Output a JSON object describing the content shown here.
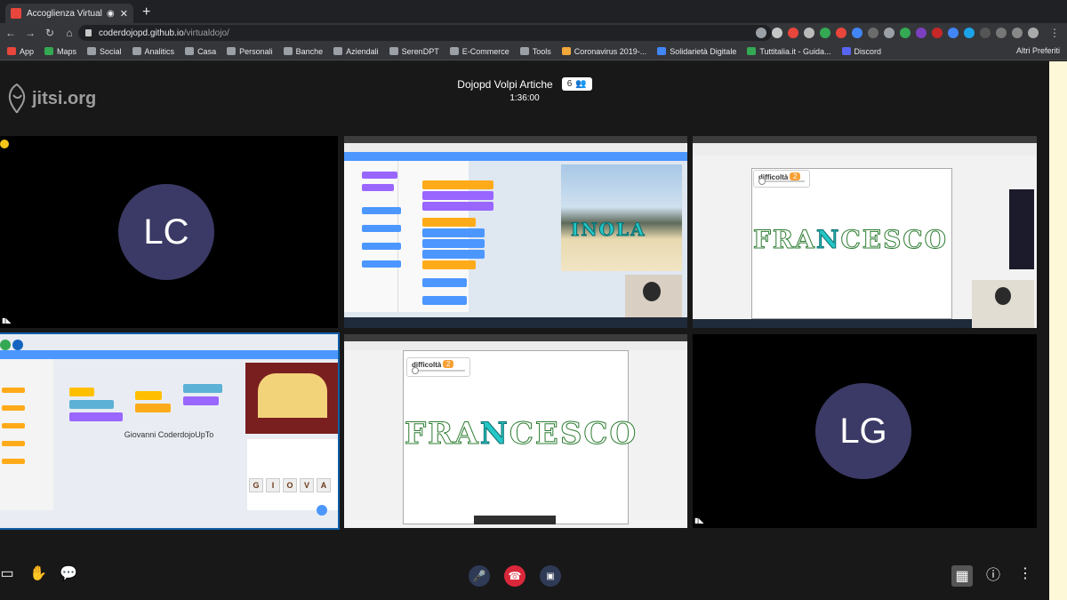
{
  "browser": {
    "tab_title": "Accoglienza Virtual Dojo",
    "url_host": "coderdojopd.github.io",
    "url_path": "/virtualdojo/",
    "bookmarks": [
      {
        "label": "App",
        "color": "#e8453c"
      },
      {
        "label": "Maps",
        "color": "#34a853"
      },
      {
        "label": "Social",
        "color": "#9aa0a6"
      },
      {
        "label": "Analitics",
        "color": "#9aa0a6"
      },
      {
        "label": "Casa",
        "color": "#9aa0a6"
      },
      {
        "label": "Personali",
        "color": "#9aa0a6"
      },
      {
        "label": "Banche",
        "color": "#9aa0a6"
      },
      {
        "label": "Aziendali",
        "color": "#9aa0a6"
      },
      {
        "label": "SerenDPT",
        "color": "#9aa0a6"
      },
      {
        "label": "E-Commerce",
        "color": "#9aa0a6"
      },
      {
        "label": "Tools",
        "color": "#9aa0a6"
      },
      {
        "label": "Coronavirus 2019-...",
        "color": "#f2a93b"
      },
      {
        "label": "Solidarietà Digitale",
        "color": "#4285f4"
      },
      {
        "label": "Tuttitalia.it - Guida...",
        "color": "#34a853"
      },
      {
        "label": "Discord",
        "color": "#5865f2"
      }
    ],
    "bookmarks_right": "Altri Preferiti"
  },
  "conference": {
    "logo": "jitsi.org",
    "title": "Dojopd Volpi Artiche",
    "participants": "6",
    "timer": "1:36:00"
  },
  "tiles": {
    "lc": {
      "initials": "LC"
    },
    "scratch_top": {
      "word": "INOLA"
    },
    "francesco_top": {
      "diff_label": "difficoltà",
      "diff_value": "2",
      "word_pre": "FRA",
      "word_hl": "N",
      "word_post": "CESCO"
    },
    "giovanni": {
      "name": "Giovanni CoderdojoUpTo",
      "letters": [
        "G",
        "I",
        "O",
        "V",
        "A"
      ]
    },
    "francesco_bottom": {
      "diff_label": "difficoltà",
      "diff_value": "2",
      "word_pre": "FRA",
      "word_hl": "N",
      "word_post": "CESCO"
    },
    "lg": {
      "initials": "LG"
    }
  }
}
